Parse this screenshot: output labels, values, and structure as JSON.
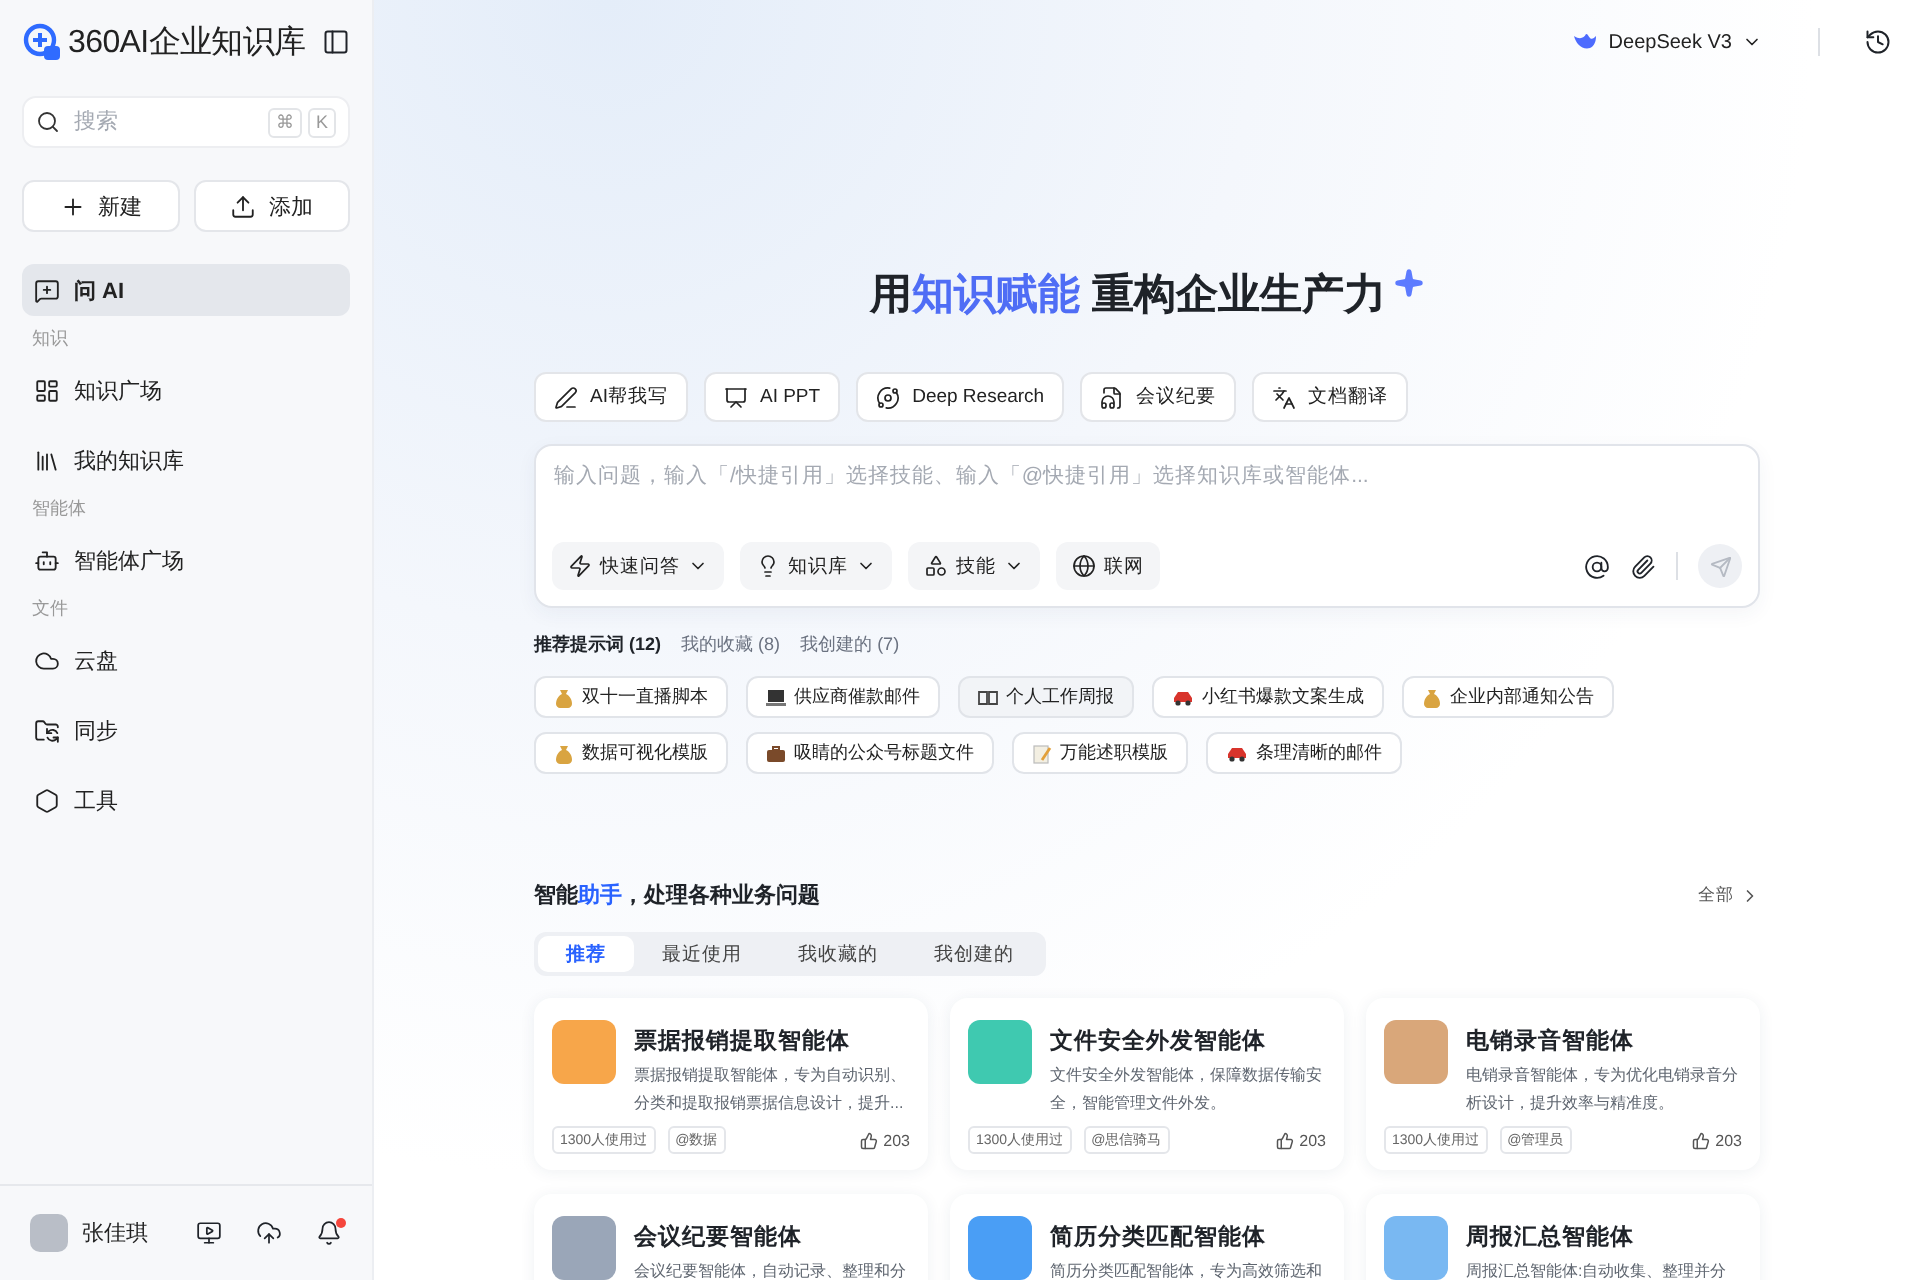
{
  "brand": {
    "name": "360AI企业知识库"
  },
  "search": {
    "placeholder": "搜索",
    "keys": [
      "⌘",
      "K"
    ]
  },
  "actions": [
    {
      "label": "新建"
    },
    {
      "label": "添加"
    }
  ],
  "nav": [
    {
      "kind": "item",
      "label": "问 AI",
      "selected": true
    },
    {
      "kind": "section",
      "label": "知识"
    },
    {
      "kind": "item",
      "label": "知识广场",
      "selected": false
    },
    {
      "kind": "item",
      "label": "我的知识库",
      "selected": false
    },
    {
      "kind": "section",
      "label": "智能体"
    },
    {
      "kind": "item",
      "label": "智能体广场",
      "selected": false
    },
    {
      "kind": "section",
      "label": "文件"
    },
    {
      "kind": "item",
      "label": "云盘",
      "selected": false
    },
    {
      "kind": "item",
      "label": "同步",
      "selected": false
    },
    {
      "kind": "item",
      "label": "工具",
      "selected": false
    }
  ],
  "user": {
    "name": "张佳琪",
    "unread": true
  },
  "model": {
    "name": "DeepSeek V3"
  },
  "hero": {
    "start": "用",
    "highlight": "知识赋能",
    "end": "重构企业生产力"
  },
  "tools": [
    {
      "label": "AI帮我写"
    },
    {
      "label": "AI PPT"
    },
    {
      "label": "Deep Research"
    },
    {
      "label": "会议纪要"
    },
    {
      "label": "文档翻译"
    }
  ],
  "composer": {
    "placeholder": "输入问题，输入「/快捷引用」选择技能、输入「@快捷引用」选择知识库或智能体...",
    "options": [
      {
        "label": "快速问答",
        "dropdown": true
      },
      {
        "label": "知识库",
        "dropdown": true
      },
      {
        "label": "技能",
        "dropdown": true
      },
      {
        "label": "联网",
        "dropdown": false
      }
    ]
  },
  "prompt_tabs": [
    {
      "label": "推荐提示词",
      "count": "(12)",
      "selected": true
    },
    {
      "label": "我的收藏",
      "count": "(8)",
      "selected": false
    },
    {
      "label": "我创建的",
      "count": "(7)",
      "selected": false
    }
  ],
  "prompts": [
    {
      "kind": "bag",
      "label": "双十一直播脚本",
      "selected": false
    },
    {
      "kind": "laptop",
      "label": "供应商催款邮件",
      "selected": false
    },
    {
      "kind": "book",
      "label": "个人工作周报",
      "selected": true
    },
    {
      "kind": "car",
      "label": "小红书爆款文案生成",
      "selected": false
    },
    {
      "kind": "bag",
      "label": "企业内部通知公告",
      "selected": false
    },
    {
      "kind": "bag",
      "label": "数据可视化模版",
      "selected": false
    },
    {
      "kind": "briefcase",
      "label": "吸睛的公众号标题文件",
      "selected": false
    },
    {
      "kind": "memo",
      "label": "万能述职模版",
      "selected": false
    },
    {
      "kind": "car",
      "label": "条理清晰的邮件",
      "selected": false
    }
  ],
  "assistants": {
    "title_start": "智能",
    "title_highlight": "助手",
    "title_end": "，处理各种业务问题",
    "more": "全部",
    "tabs": [
      {
        "label": "推荐",
        "selected": true
      },
      {
        "label": "最近使用",
        "selected": false
      },
      {
        "label": "我收藏的",
        "selected": false
      },
      {
        "label": "我创建的",
        "selected": false
      }
    ],
    "cards": [
      {
        "title": "票据报销提取智能体",
        "color": "#f7a64a",
        "description": "票据报销提取智能体，专为自动识别、分类和提取报销票据信息设计，提升...",
        "users": "1300人使用过",
        "author": "@数据",
        "likes": "203"
      },
      {
        "title": "文件安全外发智能体",
        "color": "#3fc9b0",
        "description": "文件安全外发智能体，保障数据传输安全，智能管理文件外发。",
        "users": "1300人使用过",
        "author": "@思信骑马",
        "likes": "203"
      },
      {
        "title": "电销录音智能体",
        "color": "#d9a77a",
        "description": "电销录音智能体，专为优化电销录音分析设计，提升效率与精准度。",
        "users": "1300人使用过",
        "author": "@管理员",
        "likes": "203"
      },
      {
        "title": "会议纪要智能体",
        "color": "#9aa6b8",
        "description": "会议纪要智能体，自动记录、整理和分"
      },
      {
        "title": "简历分类匹配智能体",
        "color": "#4a9ef5",
        "description": "简历分类匹配智能体，专为高效筛选和"
      },
      {
        "title": "周报汇总智能体",
        "color": "#79b8f2",
        "description": "周报汇总智能体:自动收集、整理并分"
      }
    ]
  }
}
